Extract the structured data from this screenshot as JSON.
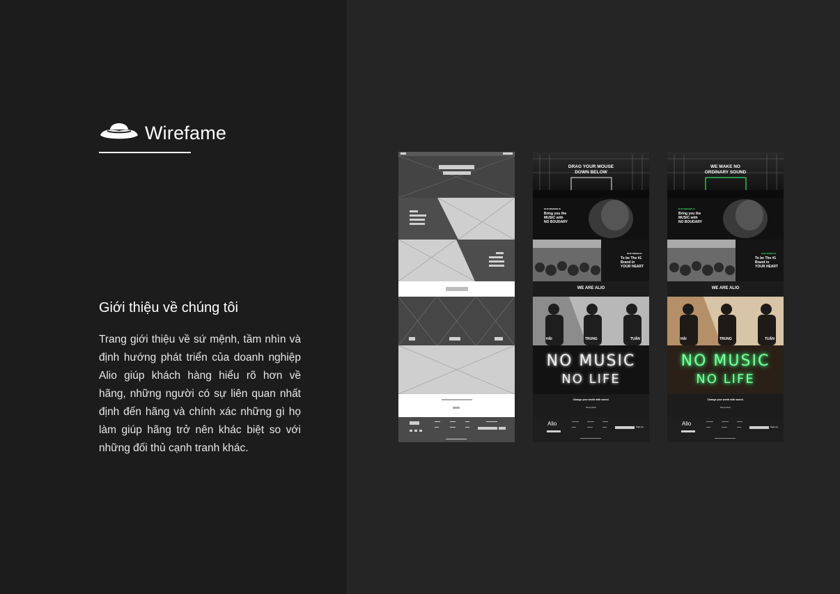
{
  "brand": {
    "title": "Wirefame",
    "icon": "ufo-icon"
  },
  "about": {
    "heading": "Giới thiệu về chúng tôi",
    "body": "Trang giới thiệu về sứ mệnh, tầm nhìn và định hướng phát triển của doanh nghiệp Alio giúp khách hàng hiểu rõ hơn về hãng, những người có sự liên quan nhất định đến hãng và chính xác những gì họ làm giúp hãng trở nên khác biệt so với những đối thủ cạnh tranh khác."
  },
  "mock_bw": {
    "hero": "DRAG YOUR MOUSE DOWN BELOW",
    "s2_small": "OUR MISSION IS",
    "s2_text": "Bring you the MUSIC with NO BOUDARY",
    "s3_small": "OUR VISION IS",
    "s3_text": "To be The #1 Brand in YOUR HEART",
    "team_title": "WE ARE ALIO",
    "members": [
      "HẢI",
      "TRUNG",
      "TUẤN"
    ],
    "neon1": "NO MUSIC",
    "neon2": "NO LIFE",
    "cta": "Change your world with sound.",
    "cta_sub": "Shop Now",
    "footer_logo": "Alio",
    "button": "Sign up"
  },
  "mock_color": {
    "hero": "WE MAKE NO ORDINARY SOUND",
    "s2_small": "OUR MISSION IS",
    "s2_text": "Bring you the MUSIC with NO BOUDARY",
    "s3_small": "OUR VISION IS",
    "s3_text": "To be The #1 Brand in YOUR HEART",
    "team_title": "WE ARE ALIO",
    "members": [
      "HẢI",
      "TRUNG",
      "TUẤN"
    ],
    "neon1": "NO MUSIC",
    "neon2": "NO LIFE",
    "cta": "Change your world with sound.",
    "cta_sub": "Shop Now",
    "footer_logo": "Alio",
    "button": "Sign up"
  },
  "colors": {
    "left_panel": "#1c1c1c",
    "background": "#252525",
    "accent_green": "#39e26a"
  }
}
